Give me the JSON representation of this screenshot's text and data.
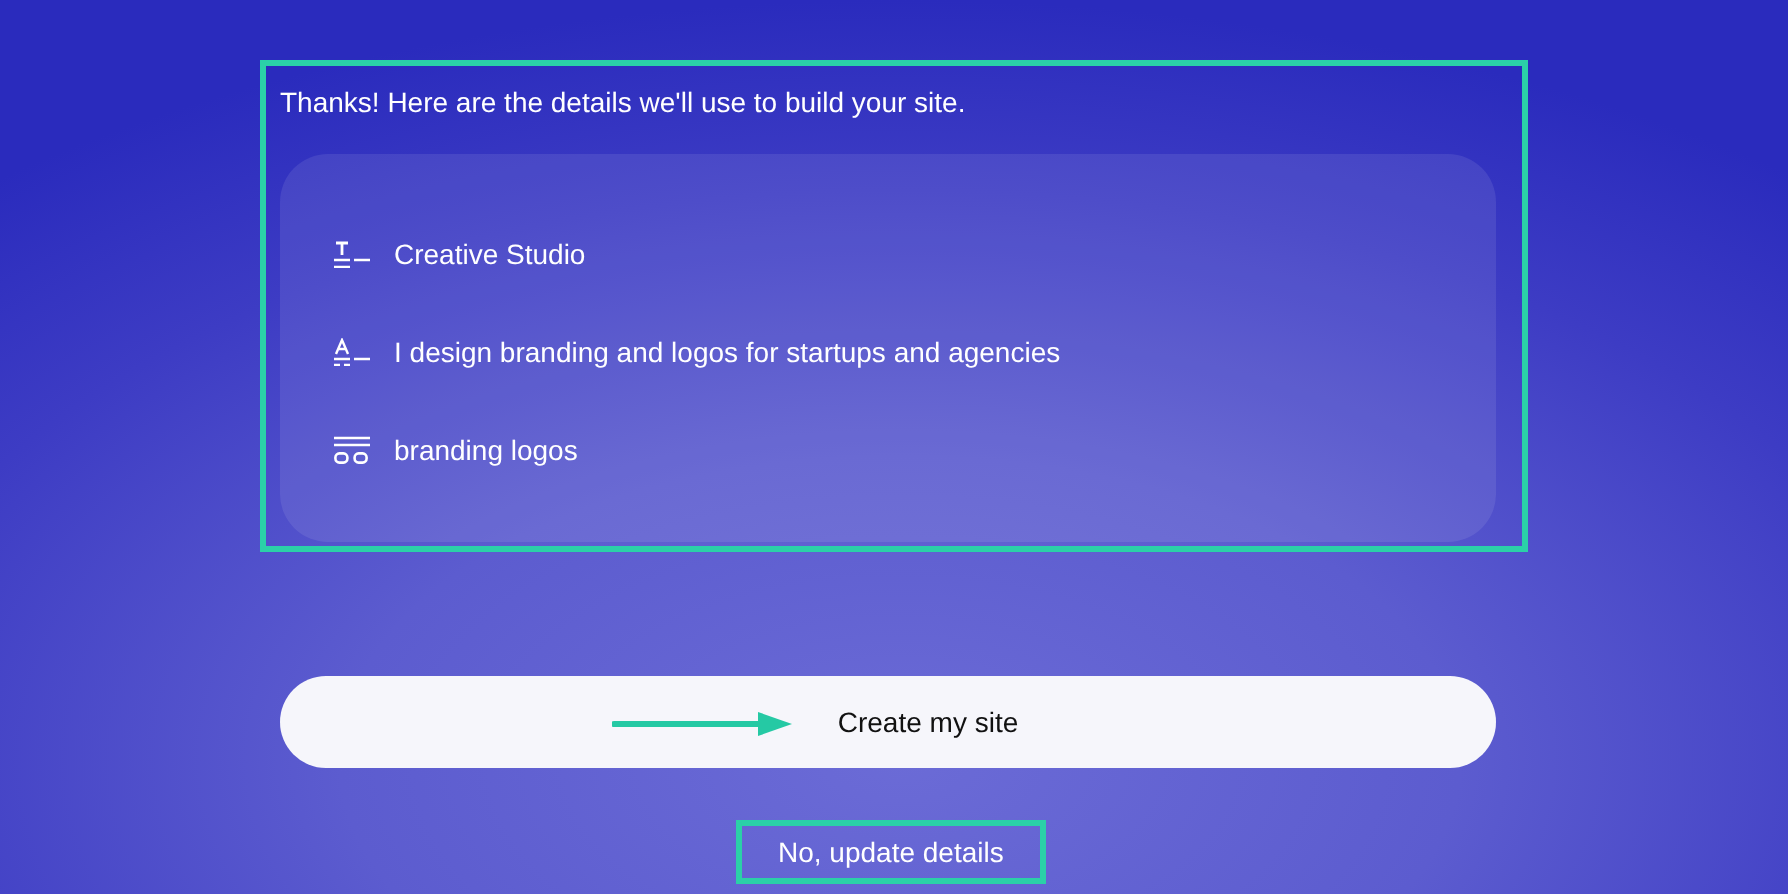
{
  "summary": {
    "heading": "Thanks! Here are the details we'll use to build your site.",
    "highlighted": true,
    "items": [
      {
        "kind": "title",
        "text": "Creative Studio"
      },
      {
        "kind": "description",
        "text": "I design branding and logos for startups and agencies"
      },
      {
        "kind": "tags",
        "text": "branding logos"
      }
    ]
  },
  "primary_button": {
    "label": "Create my site",
    "pointer": true
  },
  "secondary_link": {
    "label": "No, update details",
    "highlighted": true
  }
}
